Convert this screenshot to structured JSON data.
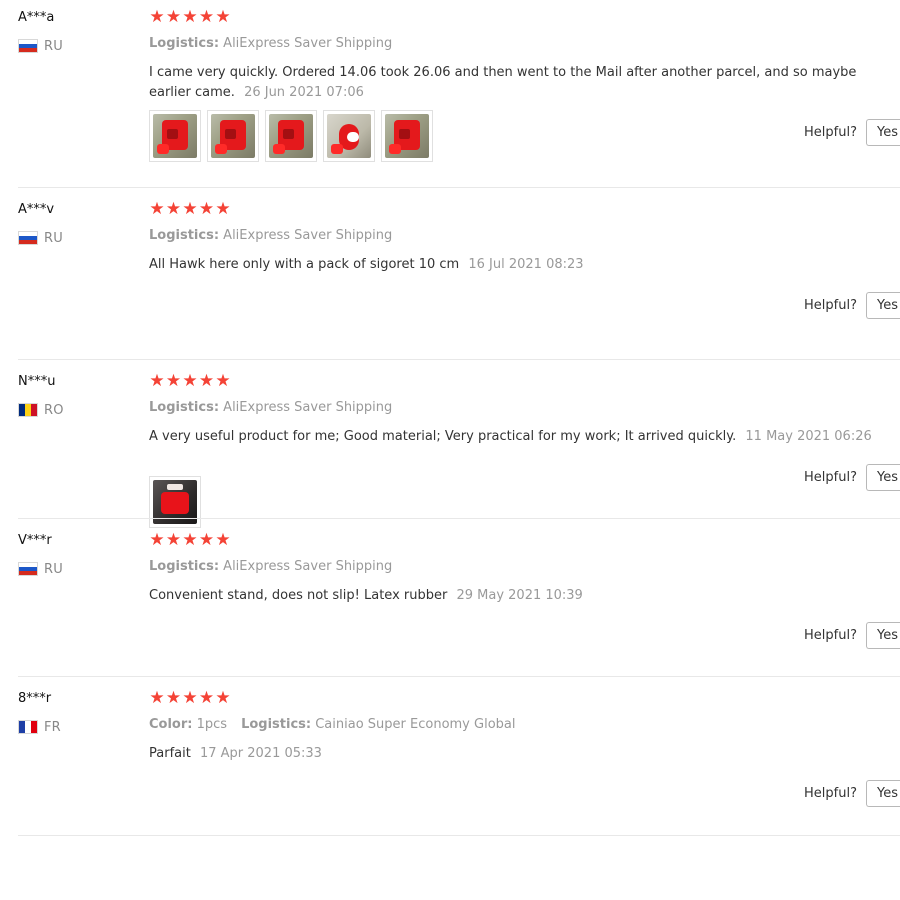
{
  "page": {
    "helpful_label": "Helpful?",
    "yes_label": "Yes",
    "star_color": "#f44336",
    "star_count": 5
  },
  "reviews": [
    {
      "user": "A***a",
      "country": "RU",
      "flag": "ru",
      "rating": 5,
      "meta": [
        {
          "label": "Logistics:",
          "value": "AliExpress Saver Shipping"
        }
      ],
      "text": "I came very quickly. Ordered 14.06 took 26.06 and then went to the Mail after another parcel, and so maybe earlier came.",
      "date": "26 Jun 2021 07:06",
      "photos": [
        "red-stand-photo-1",
        "red-stand-photo-2",
        "red-stand-photo-3",
        "red-stand-photo-4",
        "red-stand-photo-5"
      ]
    },
    {
      "user": "A***v",
      "country": "RU",
      "flag": "ru",
      "rating": 5,
      "meta": [
        {
          "label": "Logistics:",
          "value": "AliExpress Saver Shipping"
        }
      ],
      "text": "All Hawk here only with a pack of sigoret 10 cm",
      "date": "16 Jul 2021 08:23",
      "photos": [
        "red-stand-in-pack-photo"
      ]
    },
    {
      "user": "N***u",
      "country": "RO",
      "flag": "ro",
      "rating": 5,
      "meta": [
        {
          "label": "Logistics:",
          "value": "AliExpress Saver Shipping"
        }
      ],
      "text": "A very useful product for me; Good material; Very practical for my work; It arrived quickly.",
      "date": "11 May 2021 06:26",
      "photos": []
    },
    {
      "user": "V***r",
      "country": "RU",
      "flag": "ru",
      "rating": 5,
      "meta": [
        {
          "label": "Logistics:",
          "value": "AliExpress Saver Shipping"
        }
      ],
      "text": "Convenient stand, does not slip! Latex rubber",
      "date": "29 May 2021 10:39",
      "photos": []
    },
    {
      "user": "8***r",
      "country": "FR",
      "flag": "fr",
      "rating": 5,
      "meta": [
        {
          "label": "Color:",
          "value": "1pcs"
        },
        {
          "label": "Logistics:",
          "value": "Cainiao Super Economy Global"
        }
      ],
      "text": "Parfait",
      "date": "17 Apr 2021 05:33",
      "photos": []
    }
  ]
}
